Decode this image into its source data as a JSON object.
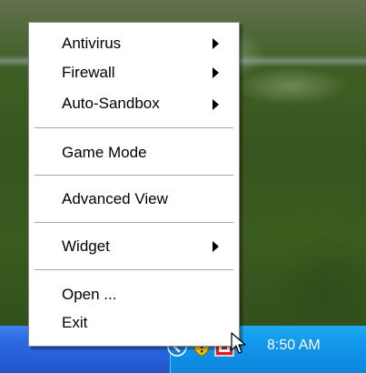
{
  "menu": {
    "items": [
      {
        "label": "Antivirus",
        "submenu": true
      },
      {
        "label": "Firewall",
        "submenu": true
      },
      {
        "label": "Auto-Sandbox",
        "submenu": true
      },
      {
        "label": "Game Mode",
        "submenu": false
      },
      {
        "label": "Advanced View",
        "submenu": false
      },
      {
        "label": "Widget",
        "submenu": true
      },
      {
        "label": "Open ...",
        "submenu": false
      },
      {
        "label": "Exit",
        "submenu": false
      }
    ]
  },
  "taskbar": {
    "clock": "8:50 AM",
    "tray_icons": [
      "chevron-left-icon",
      "shield-warning-icon",
      "comodo-icon"
    ]
  },
  "colors": {
    "taskbar": "#2560d8",
    "tray": "#0d86dc",
    "menu_bg": "#ffffff",
    "separator": "#a7a6a0"
  }
}
